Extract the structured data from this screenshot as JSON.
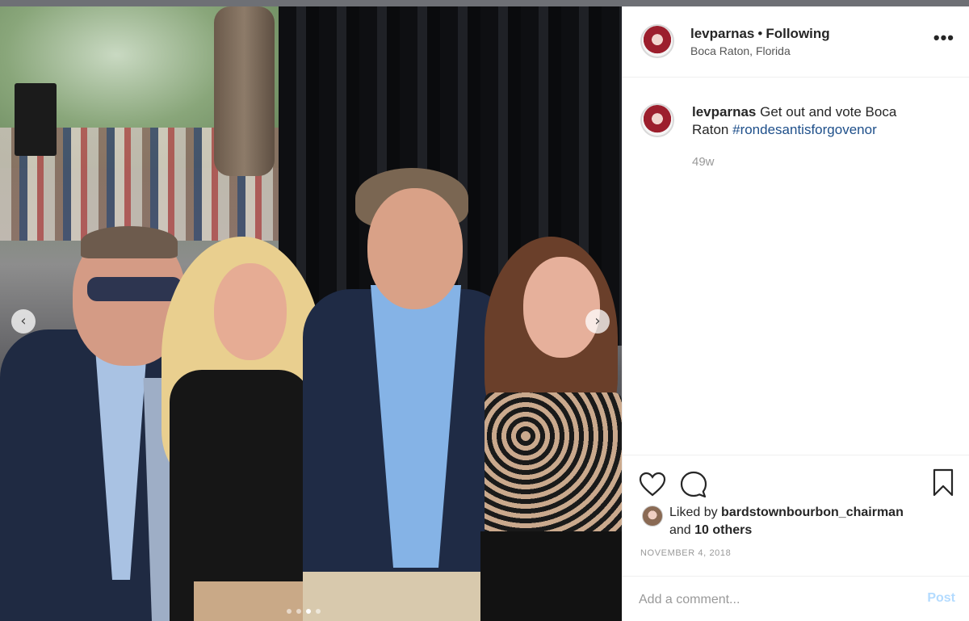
{
  "post": {
    "username": "levparnas",
    "separator": "•",
    "follow_status": "Following",
    "location": "Boca Raton, Florida",
    "more_icon": "more-options-icon",
    "more_glyph": "•••"
  },
  "caption": {
    "username": "levparnas",
    "text": "Get out and vote Boca Raton",
    "hashtag": "#rondesantisforgovenor",
    "age": "49w"
  },
  "actions": {
    "heart_icon": "heart-icon",
    "comment_icon": "comment-icon",
    "bookmark_icon": "bookmark-icon"
  },
  "likes": {
    "prefix": "Liked by",
    "user": "bardstownbourbon_chairman",
    "and": "and",
    "others": "10 others"
  },
  "date": "NOVEMBER 4, 2018",
  "comment": {
    "placeholder": "Add a comment...",
    "post_label": "Post"
  },
  "carousel": {
    "prev_glyph": "‹",
    "next_glyph": "›",
    "total_slides": 4,
    "active_slide": 3
  },
  "colors": {
    "hashtag": "#1e4f8a",
    "post_disabled": "#b3dbff",
    "secondary_text": "#999999"
  }
}
